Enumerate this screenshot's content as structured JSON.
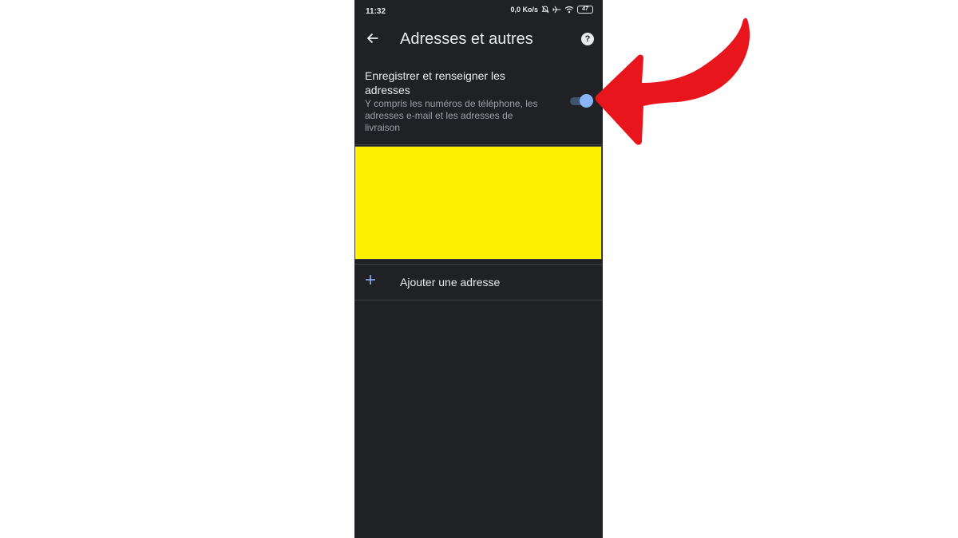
{
  "status_bar": {
    "time": "11:32",
    "network_speed": "0,0 Ko/s",
    "icons": [
      "bell-off-icon",
      "airplane-icon",
      "wifi-icon",
      "battery-icon"
    ],
    "battery_level": "47"
  },
  "app_bar": {
    "back_icon": "arrow-left-icon",
    "title": "Adresses et autres",
    "help_icon": "help-circle-icon",
    "help_glyph": "?"
  },
  "setting": {
    "title": "Enregistrer et renseigner les adresses",
    "description": "Y compris les numéros de téléphone, les adresses e-mail et les adresses de livraison",
    "toggle_on": true
  },
  "add_address": {
    "icon": "plus-icon",
    "label": "Ajouter une adresse"
  },
  "colors": {
    "background": "#202124",
    "text_primary": "#e8eaed",
    "text_secondary": "#9aa0a6",
    "accent": "#8ab4f8",
    "redaction": "#fff200",
    "annotation_arrow": "#e8161c"
  }
}
